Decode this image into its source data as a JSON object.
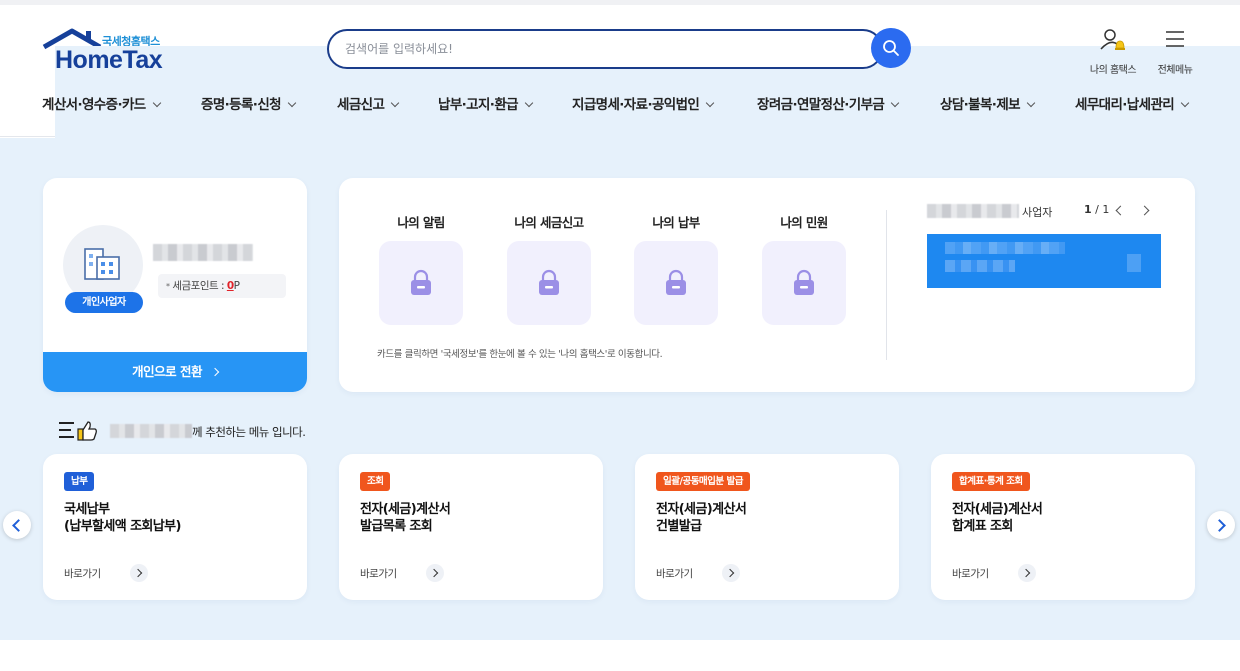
{
  "header": {
    "logo_sub": "국세청홈택스",
    "logo_main": "HomeTax",
    "search_placeholder": "검색어를 입력하세요!",
    "my_hometax_label": "나의 홈택스",
    "all_menu_label": "전체메뉴"
  },
  "nav": {
    "items": [
      {
        "label": "계산서·영수증·카드"
      },
      {
        "label": "증명·등록·신청"
      },
      {
        "label": "세금신고"
      },
      {
        "label": "납부·고지·환급"
      },
      {
        "label": "지급명세·자료·공익법인"
      },
      {
        "label": "장려금·연말정산·기부금"
      },
      {
        "label": "상담·불복·제보"
      },
      {
        "label": "세무대리·납세관리"
      }
    ]
  },
  "profile": {
    "type_badge": "개인사업자",
    "point_label": "세금포인트 : ",
    "point_value": "0",
    "point_unit": "P",
    "switch_label": "개인으로 전환"
  },
  "my": {
    "tiles": [
      {
        "label": "나의 알림"
      },
      {
        "label": "나의 세금신고"
      },
      {
        "label": "나의 납부"
      },
      {
        "label": "나의 민원"
      }
    ],
    "description": "카드를 클릭하면 '국세정보'를 한눈에 볼 수 있는 '나의 홈택스'로 이동합니다.",
    "business_label": "사업자",
    "page_current": "1",
    "page_total": " / 1"
  },
  "recommend": {
    "suffix": "께 추천하는 메뉴 입니다.",
    "go_label": "바로가기",
    "cards": [
      {
        "tag": "납부",
        "tag_color": "#1f5fd8",
        "title": "국세납부\n(납부할세액 조회납부)"
      },
      {
        "tag": "조회",
        "tag_color": "#f0561d",
        "title": "전자(세금)계산서\n발급목록 조회"
      },
      {
        "tag": "일괄/공동매입분 발급",
        "tag_color": "#f0561d",
        "title": "전자(세금)계산서\n건별발급"
      },
      {
        "tag": "합계표·통계 조회",
        "tag_color": "#f0561d",
        "title": "전자(세금)계산서\n합계표 조회"
      }
    ]
  },
  "colors": {
    "brand_blue": "#2b6bf0",
    "switch_blue": "#2795f5",
    "background": "#e6f1fb",
    "accent_red": "#e0232a"
  }
}
